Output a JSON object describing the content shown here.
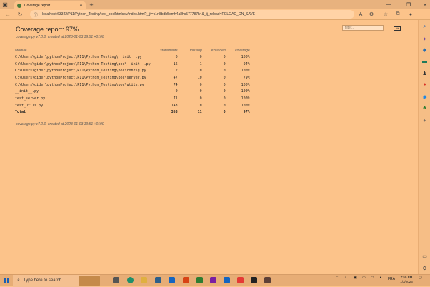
{
  "browser": {
    "tab_title": "Coverage report",
    "url": "localhost:63342/P11/Python_Testing/test_poc/htmlcov/index.html?_ijt=k1rf8bdb5omh4a8hc577787h4&_ij_reload=RELOAD_ON_SAVE"
  },
  "report": {
    "title": "Coverage report: 97%",
    "created": "coverage.py v7.0.0, created at 2023-01-03 19:51 +0100",
    "filter_placeholder": "filter...",
    "columns": [
      "Module",
      "statements",
      "missing",
      "excluded",
      "coverage"
    ],
    "rows": [
      {
        "module": "C:\\Users\\gider\\pythonProject\\P11\\Python_Testing\\__init__.py",
        "statements": "0",
        "missing": "0",
        "excluded": "0",
        "coverage": "100%"
      },
      {
        "module": "C:\\Users\\gider\\pythonProject\\P11\\Python_Testing\\poc\\__init__.py",
        "statements": "16",
        "missing": "1",
        "excluded": "0",
        "coverage": "94%"
      },
      {
        "module": "C:\\Users\\gider\\pythonProject\\P11\\Python_Testing\\poc\\config.py",
        "statements": "2",
        "missing": "0",
        "excluded": "0",
        "coverage": "100%"
      },
      {
        "module": "C:\\Users\\gider\\pythonProject\\P11\\Python_Testing\\poc\\server.py",
        "statements": "47",
        "missing": "10",
        "excluded": "0",
        "coverage": "79%"
      },
      {
        "module": "C:\\Users\\gider\\pythonProject\\P11\\Python_Testing\\poc\\utils.py",
        "statements": "74",
        "missing": "0",
        "excluded": "0",
        "coverage": "100%"
      },
      {
        "module": "__init__.py",
        "statements": "0",
        "missing": "0",
        "excluded": "0",
        "coverage": "100%"
      },
      {
        "module": "test_server.py",
        "statements": "71",
        "missing": "0",
        "excluded": "0",
        "coverage": "100%"
      },
      {
        "module": "test_utils.py",
        "statements": "143",
        "missing": "0",
        "excluded": "0",
        "coverage": "100%"
      }
    ],
    "total": {
      "module": "Total",
      "statements": "353",
      "missing": "11",
      "excluded": "0",
      "coverage": "97%"
    },
    "footer": "coverage.py v7.0.0, created at 2023-01-03 19:51 +0100"
  },
  "taskbar": {
    "search_placeholder": "Type here to search",
    "language": "FRA",
    "time": "7:59 PM",
    "date": "1/3/2023"
  },
  "colors": {
    "page_background": "#FCC38A",
    "taskbar": "#E7AD76"
  }
}
